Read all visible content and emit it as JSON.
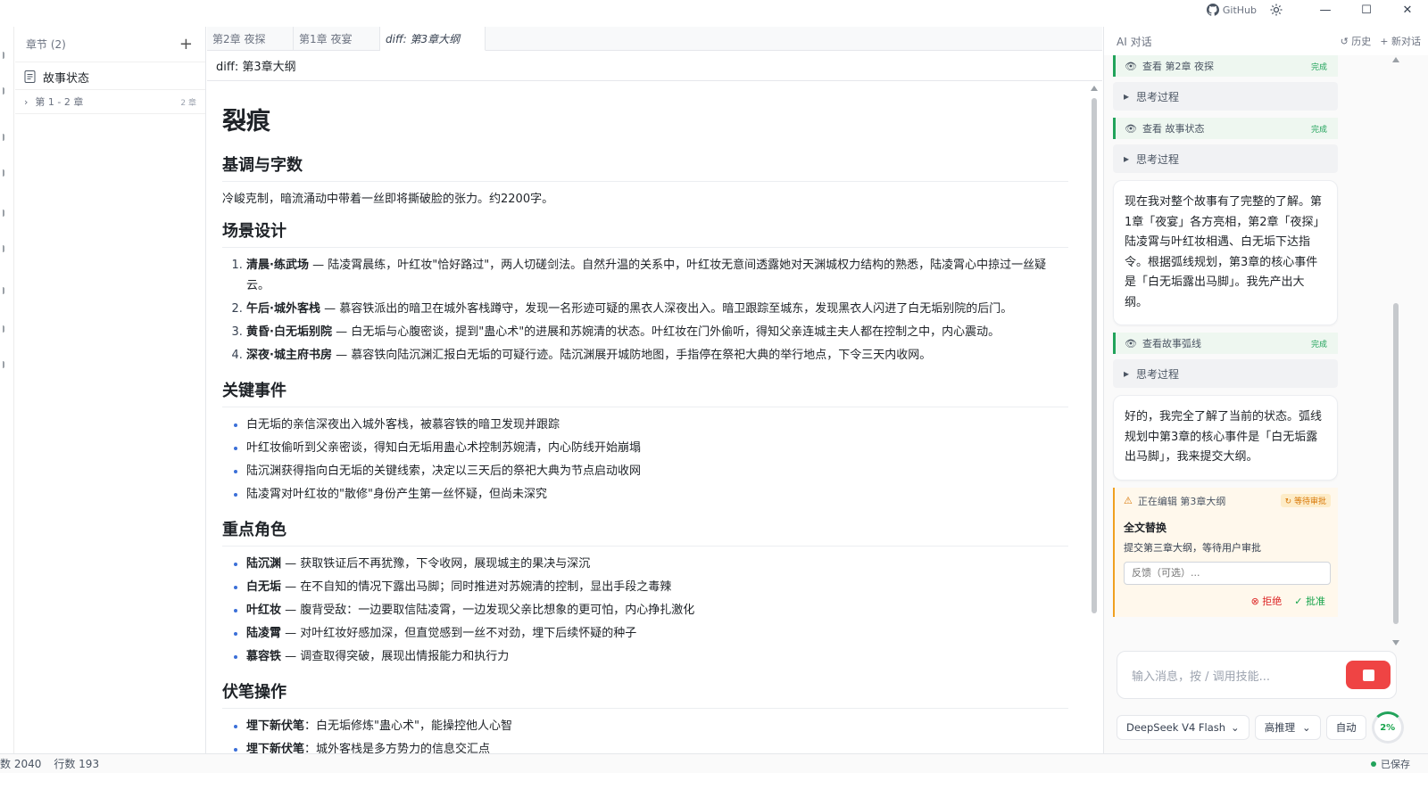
{
  "titlebar": {
    "github_label": "GitHub",
    "minimize": "—",
    "maximize": "☐",
    "close": "✕"
  },
  "chapters": {
    "header": "章节 (2)",
    "add": "+",
    "story_state": "故事状态",
    "group_label": "第 1 - 2 章",
    "group_count": "2 章"
  },
  "editor": {
    "tabs": [
      "第2章 夜探",
      "第1章 夜宴",
      "diff: 第3章大纲"
    ],
    "doc_title": "diff: 第3章大纲",
    "doc": {
      "h1": "裂痕",
      "s1_title": "基调与字数",
      "s1_text": "冷峻克制，暗流涌动中带着一丝即将撕破脸的张力。约2200字。",
      "s2_title": "场景设计",
      "scenes": [
        {
          "b": "清晨·练武场",
          "t": " — 陆凌霄晨练，叶红妆\"恰好路过\"，两人切磋剑法。自然升温的关系中，叶红妆无意间透露她对天渊城权力结构的熟悉，陆凌霄心中掠过一丝疑云。"
        },
        {
          "b": "午后·城外客栈",
          "t": " — 慕容铁派出的暗卫在城外客栈蹲守，发现一名形迹可疑的黑衣人深夜出入。暗卫跟踪至城东，发现黑衣人闪进了白无垢别院的后门。"
        },
        {
          "b": "黄昏·白无垢别院",
          "t": " — 白无垢与心腹密谈，提到\"蛊心术\"的进展和苏婉清的状态。叶红妆在门外偷听，得知父亲连城主夫人都在控制之中，内心震动。"
        },
        {
          "b": "深夜·城主府书房",
          "t": " — 慕容铁向陆沉渊汇报白无垢的可疑行迹。陆沉渊展开城防地图，手指停在祭祀大典的举行地点，下令三天内收网。"
        }
      ],
      "s3_title": "关键事件",
      "events": [
        "白无垢的亲信深夜出入城外客栈，被慕容铁的暗卫发现并跟踪",
        "叶红妆偷听到父亲密谈，得知白无垢用蛊心术控制苏婉清，内心防线开始崩塌",
        "陆沉渊获得指向白无垢的关键线索，决定以三天后的祭祀大典为节点启动收网",
        "陆凌霄对叶红妆的\"散修\"身份产生第一丝怀疑，但尚未深究"
      ],
      "s4_title": "重点角色",
      "roles": [
        {
          "b": "陆沉渊",
          "t": " — 获取铁证后不再犹豫，下令收网，展现城主的果决与深沉"
        },
        {
          "b": "白无垢",
          "t": " — 在不自知的情况下露出马脚；同时推进对苏婉清的控制，显出手段之毒辣"
        },
        {
          "b": "叶红妆",
          "t": " — 腹背受敌：一边要取信陆凌霄，一边发现父亲比想象的更可怕，内心挣扎激化"
        },
        {
          "b": "陆凌霄",
          "t": " — 对叶红妆好感加深，但直觉感到一丝不对劲，埋下后续怀疑的种子"
        },
        {
          "b": "慕容铁",
          "t": " — 调查取得突破，展现出情报能力和执行力"
        }
      ],
      "s5_title": "伏笔操作",
      "foreshadow": [
        {
          "b": "埋下新伏笔",
          "t": "：白无垢修炼\"蛊心术\"，能操控他人心智"
        },
        {
          "b": "埋下新伏笔",
          "t": "：城外客栈是多方势力的信息交汇点"
        }
      ]
    }
  },
  "ai": {
    "title": "AI 对话",
    "history": "历史",
    "new_chat": "新对话",
    "tool1_label": "查看 第2章 夜探",
    "tool2_label": "查看 故事状态",
    "tool3_label": "查看故事弧线",
    "done": "完成",
    "thinking": "思考过程",
    "msg1": "现在我对整个故事有了完整的了解。第1章「夜宴」各方亮相，第2章「夜探」陆凌霄与叶红妆相遇、白无垢下达指令。根据弧线规划，第3章的核心事件是「白无垢露出马脚」。我先产出大纲。",
    "msg2": "好的，我完全了解了当前的状态。弧线规划中第3章的核心事件是「白无垢露出马脚」，我来提交大纲。",
    "approval": {
      "editing": "正在编辑 第3章大纲",
      "pending": "等待审批",
      "heading": "全文替换",
      "desc": "提交第三章大纲，等待用户审批",
      "feedback_placeholder": "反馈（可选）...",
      "reject": "拒绝",
      "approve": "批准"
    },
    "input_placeholder": "输入消息，按 / 调用技能...",
    "model": "DeepSeek V4 Flash",
    "reasoning": "高推理",
    "auto": "自动",
    "context_pct": "2%"
  },
  "status": {
    "words": "数 2040",
    "lines": "行数 193",
    "saved": "已保存"
  },
  "colors": {
    "accent_green": "#22a35b",
    "danger": "#ef4444",
    "warning": "#f0a020"
  }
}
